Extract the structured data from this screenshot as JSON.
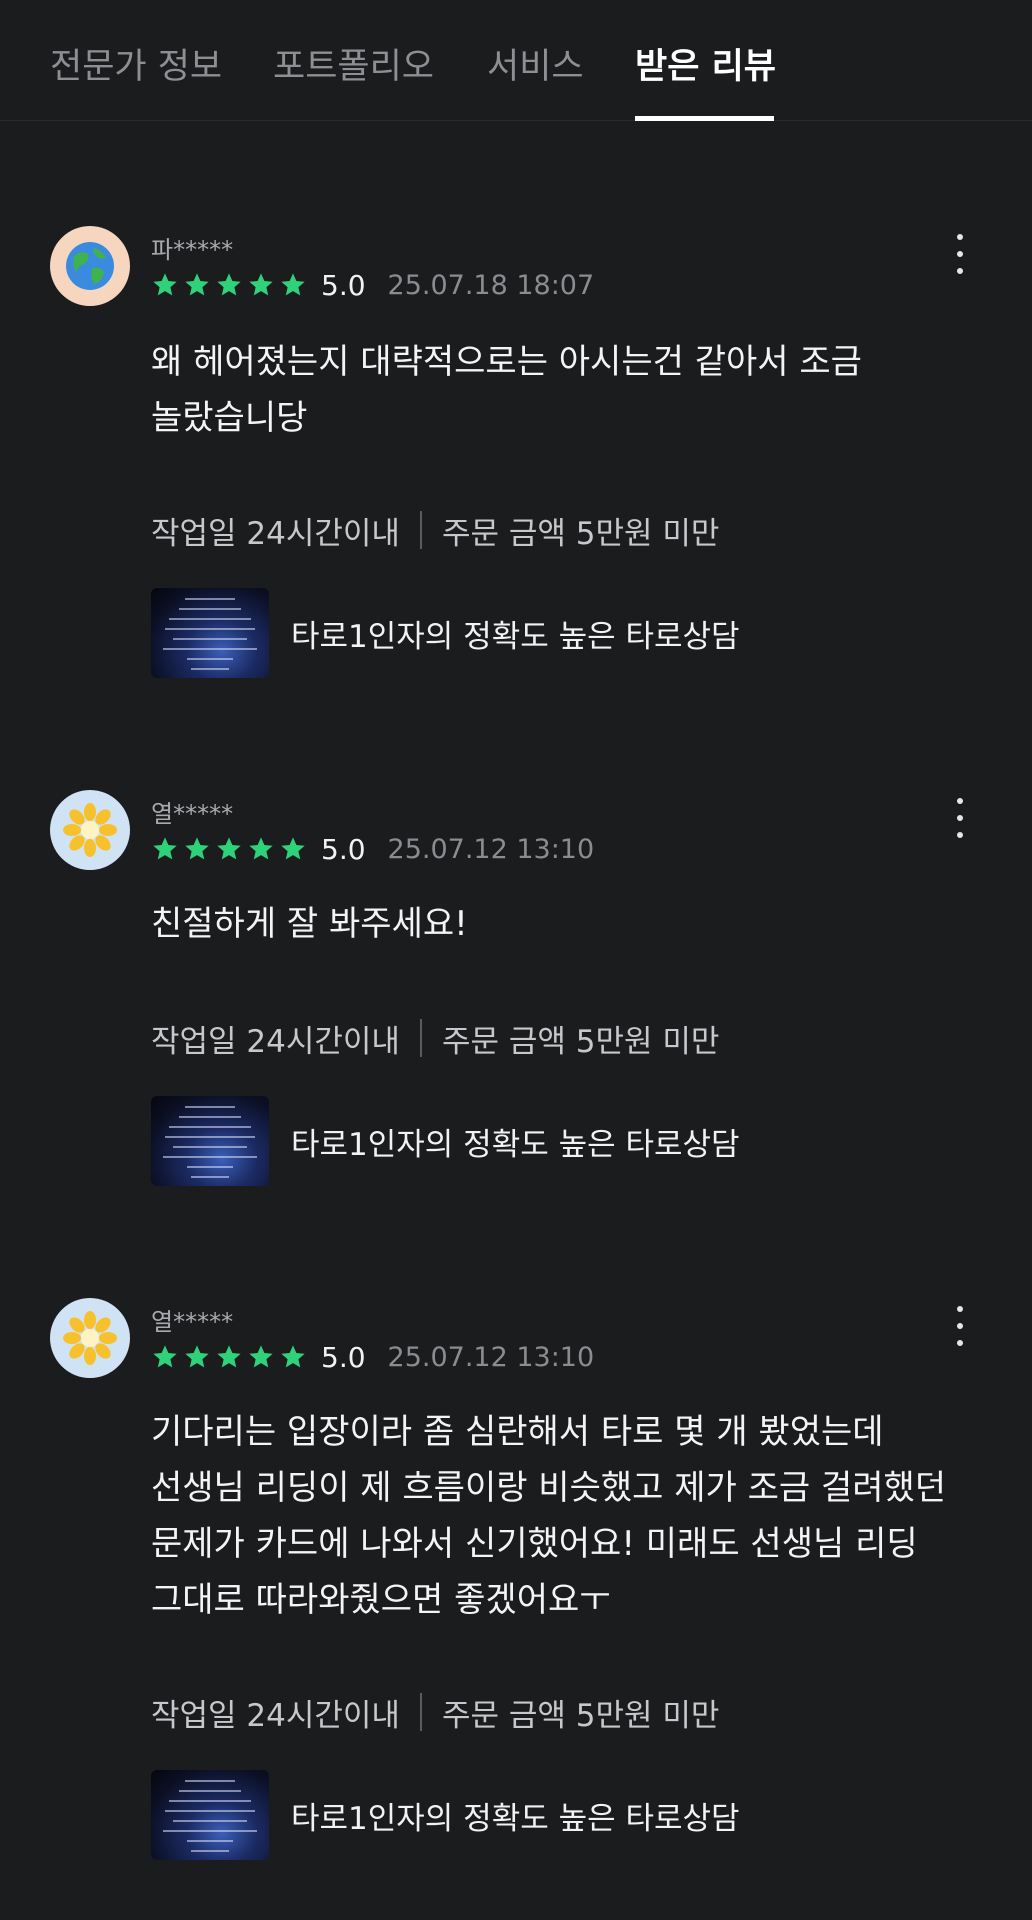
{
  "tabs": [
    {
      "label": "전문가 정보"
    },
    {
      "label": "포트폴리오"
    },
    {
      "label": "서비스"
    },
    {
      "label": "받은 리뷰"
    }
  ],
  "active_tab": "받은 리뷰",
  "accent_star_color": "#2fd27a",
  "reviews": [
    {
      "avatar_icon": "globe-icon",
      "username": "파*****",
      "stars": 5,
      "score": "5.0",
      "date": "25.07.18 18:07",
      "lines": [
        "왜 헤어졌는지 대략적으로는 아시는건 같아서 조금",
        "놀랐습니당"
      ],
      "work_days": "작업일 24시간이내",
      "order_amount": "주문 금액 5만원 미만",
      "service_title": "타로1인자의 정확도 높은 타로상담"
    },
    {
      "avatar_icon": "flower-icon",
      "username": "열*****",
      "stars": 5,
      "score": "5.0",
      "date": "25.07.12 13:10",
      "lines": [
        "친절하게 잘 봐주세요!"
      ],
      "work_days": "작업일 24시간이내",
      "order_amount": "주문 금액 5만원 미만",
      "service_title": "타로1인자의 정확도 높은 타로상담"
    },
    {
      "avatar_icon": "flower-icon",
      "username": "열*****",
      "stars": 5,
      "score": "5.0",
      "date": "25.07.12 13:10",
      "lines": [
        "기다리는 입장이라 좀 심란해서 타로 몇 개 봤었는데",
        "선생님 리딩이 제 흐름이랑 비슷했고 제가 조금 걸려했던",
        "문제가 카드에 나와서 신기했어요! 미래도 선생님 리딩",
        "그대로 따라와줬으면 좋겠어요ㅜ"
      ],
      "work_days": "작업일 24시간이내",
      "order_amount": "주문 금액 5만원 미만",
      "service_title": "타로1인자의 정확도 높은 타로상담"
    }
  ]
}
